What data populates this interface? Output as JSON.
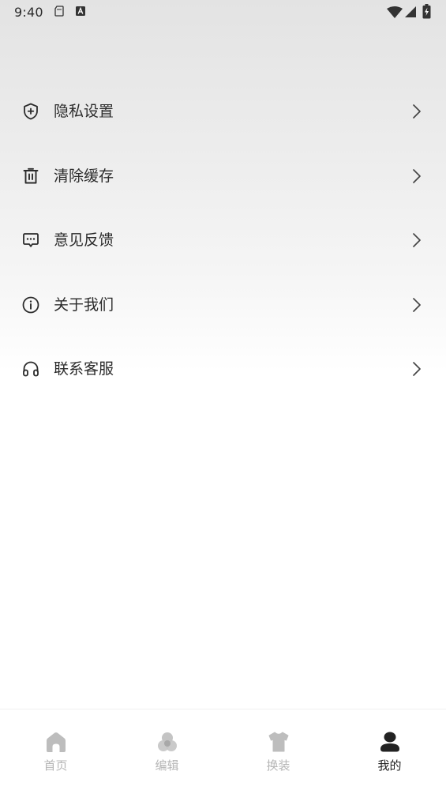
{
  "status_bar": {
    "time": "9:40",
    "icons": [
      "sd-card-icon",
      "a-badge-icon",
      "wifi-icon",
      "signal-icon",
      "battery-charging-icon"
    ]
  },
  "menu": {
    "items": [
      {
        "label": "隐私设置",
        "icon": "shield-plus-icon"
      },
      {
        "label": "清除缓存",
        "icon": "trash-icon"
      },
      {
        "label": "意见反馈",
        "icon": "chat-bubble-icon"
      },
      {
        "label": "关于我们",
        "icon": "info-icon"
      },
      {
        "label": "联系客服",
        "icon": "headset-icon"
      }
    ]
  },
  "tabbar": {
    "tabs": [
      {
        "label": "首页",
        "icon": "home-icon",
        "active": false
      },
      {
        "label": "编辑",
        "icon": "edit-circles-icon",
        "active": false
      },
      {
        "label": "换装",
        "icon": "shirt-icon",
        "active": false
      },
      {
        "label": "我的",
        "icon": "user-icon",
        "active": true
      }
    ]
  },
  "colors": {
    "text_primary": "#2b2b2b",
    "tab_inactive": "#b5b5b5",
    "tab_active": "#222222"
  }
}
